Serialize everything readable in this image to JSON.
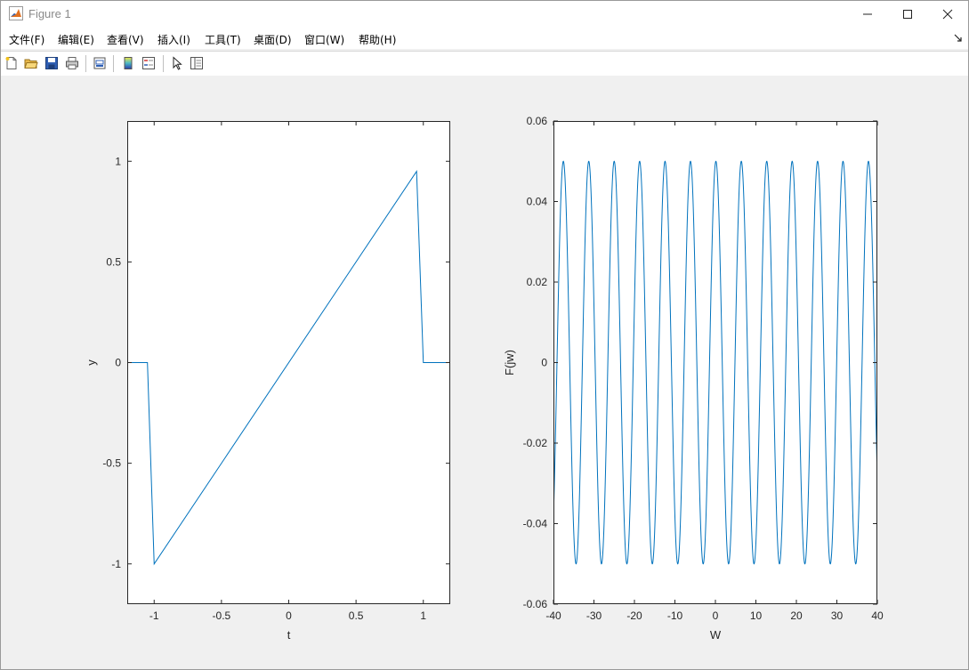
{
  "window": {
    "title": "Figure 1"
  },
  "menu": {
    "items": [
      "文件(F)",
      "编辑(E)",
      "查看(V)",
      "插入(I)",
      "工具(T)",
      "桌面(D)",
      "窗口(W)",
      "帮助(H)"
    ]
  },
  "toolbar": {
    "buttons": [
      "new-figure-icon",
      "open-file-icon",
      "save-icon",
      "print-icon",
      "link-plot-icon",
      "colorbar-icon",
      "legend-icon",
      "edit-plot-icon",
      "property-inspector-icon"
    ]
  },
  "colors": {
    "line": "#0072bd",
    "axes_bg": "#ffffff",
    "figure_bg": "#f0f0f0"
  },
  "chart_data": [
    {
      "type": "line",
      "title": "",
      "xlabel": "t",
      "ylabel": "y",
      "xlim": [
        -1.2,
        1.2
      ],
      "ylim": [
        -1.2,
        1.2
      ],
      "xticks": [
        -1,
        -0.5,
        0,
        0.5,
        1
      ],
      "xtick_labels": [
        "-1",
        "-0.5",
        "0",
        "0.5",
        "1"
      ],
      "yticks": [
        -1,
        -0.5,
        0,
        0.5,
        1
      ],
      "ytick_labels": [
        "-1",
        "-0.5",
        "0",
        "0.5",
        "1"
      ],
      "grid": false,
      "series": [
        {
          "x": [
            -1.2,
            -1.05,
            -1.0,
            0.95,
            1.0,
            1.2
          ],
          "y": [
            0,
            0,
            -1.0,
            0.95,
            0,
            0
          ]
        }
      ]
    },
    {
      "type": "line",
      "title": "",
      "xlabel": "W",
      "ylabel": "F(jw)",
      "xlim": [
        -40,
        40
      ],
      "ylim": [
        -0.06,
        0.06
      ],
      "xticks": [
        -40,
        -30,
        -20,
        -10,
        0,
        10,
        20,
        30,
        40
      ],
      "xtick_labels": [
        "-40",
        "-30",
        "-20",
        "-10",
        "0",
        "10",
        "20",
        "30",
        "40"
      ],
      "yticks": [
        -0.06,
        -0.04,
        -0.02,
        0,
        0.02,
        0.04,
        0.06
      ],
      "ytick_labels": [
        "-0.06",
        "-0.04",
        "-0.02",
        "0",
        "0.02",
        "0.04",
        "0.06"
      ],
      "grid": false,
      "series": [
        {
          "function": "sinusoid",
          "amplitude": 0.05,
          "period": 6.28,
          "phase": 1.45,
          "x_range": [
            -40,
            40
          ]
        }
      ]
    }
  ]
}
